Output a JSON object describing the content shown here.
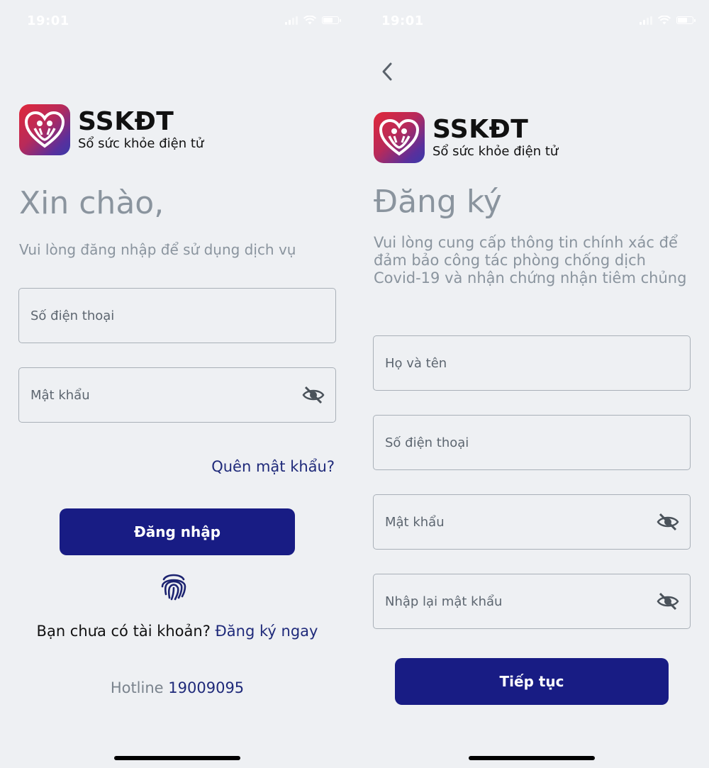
{
  "status_bar": {
    "time": "19:01"
  },
  "brand": {
    "name": "SSKĐT",
    "subtitle": "Sổ sức khỏe điện tử"
  },
  "login": {
    "heading": "Xin chào,",
    "subtext": "Vui lòng đăng nhập để sử dụng dịch vụ",
    "phone_placeholder": "Số điện thoại",
    "password_placeholder": "Mật khẩu",
    "forgot_password": "Quên mật khẩu?",
    "login_button": "Đăng nhập",
    "no_account": "Bạn chưa có tài khoản?",
    "register_now": "Đăng ký ngay",
    "hotline_label": "Hotline",
    "hotline_number": "19009095"
  },
  "register": {
    "heading": "Đăng ký",
    "subtext": "Vui lòng cung cấp thông tin chính xác để đảm bảo công tác phòng chống dịch Covid-19 và nhận chứng nhận tiêm chủng",
    "fullname_placeholder": "Họ và tên",
    "phone_placeholder": "Số điện thoại",
    "password_placeholder": "Mật khẩu",
    "confirm_password_placeholder": "Nhập lại mật khẩu",
    "continue_button": "Tiếp tục"
  },
  "colors": {
    "primary": "#181c84",
    "link": "#1f2a7a",
    "muted_text": "#8a949e",
    "background": "#eef0f3"
  },
  "icons": [
    "heart-logo-icon",
    "eye-off-icon",
    "fingerprint-icon",
    "back-chevron-icon",
    "signal-icon",
    "wifi-icon",
    "battery-icon"
  ]
}
